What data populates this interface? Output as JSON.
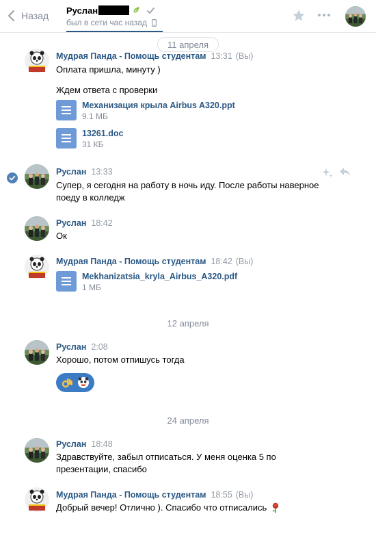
{
  "header": {
    "back_label": "Назад",
    "peer_name": "Руслан",
    "peer_status": "был в сети час назад"
  },
  "dates": [
    "11 апреля",
    "12 апреля",
    "24 апреля"
  ],
  "messages": [
    {
      "author": "Мудрая Панда - Помощь студентам",
      "time": "13:31",
      "own": "(Вы)",
      "lines": [
        "Оплата пришла, минуту )",
        "Ждем ответа с проверки"
      ]
    },
    {
      "author": "Руслан",
      "time": "13:33",
      "lines": [
        "Супер, я сегодня на работу в ночь иду. После работы наверное",
        "поеду в колледж"
      ]
    },
    {
      "author": "Руслан",
      "time": "18:42",
      "lines": [
        "Ок"
      ]
    },
    {
      "author": "Мудрая Панда - Помощь студентам",
      "time": "18:42",
      "own": "(Вы)"
    },
    {
      "author": "Руслан",
      "time": "2:08",
      "lines": [
        "Хорошо, потом отпишусь тогда"
      ]
    },
    {
      "author": "Руслан",
      "time": "18:48",
      "lines": [
        "Здравствуйте, забыл отписаться. У меня оценка 5 по",
        "презентации, спасибо"
      ]
    },
    {
      "author": "Мудрая Панда - Помощь студентам",
      "time": "18:55",
      "own": "(Вы)",
      "lines": [
        "Добрый вечер! Отлично ). Спасибо что отписались"
      ]
    }
  ],
  "documents": [
    {
      "name": "Механизация крыла Airbus A320.ppt",
      "size": "9.1 МБ"
    },
    {
      "name": "13261.doc",
      "size": "31 КБ"
    },
    {
      "name": "Mekhanizatsia_kryla_Airbus_A320.pdf",
      "size": "1 МБ"
    }
  ],
  "colors": {
    "link": "#2a5885",
    "muted": "#828a99",
    "doc_icon": "#6e9ad7",
    "sticker_bg": "#3c7cc4"
  },
  "icons": {
    "back": "chevron-left-icon",
    "star": "star-icon",
    "more": "more-dots-icon",
    "mobile": "mobile-phone-icon",
    "selected": "check-circle-icon",
    "doc": "document-icon"
  }
}
